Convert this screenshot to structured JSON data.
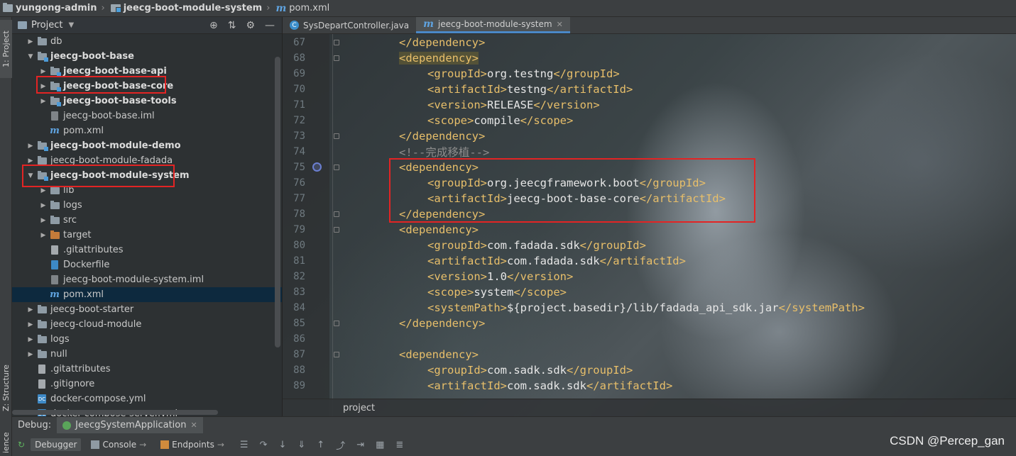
{
  "breadcrumb": {
    "items": [
      "yungong-admin",
      "jeecg-boot-module-system",
      "pom.xml"
    ]
  },
  "left_stripe": {
    "project_tab": "1: Project",
    "structure_tab": "Z: Structure",
    "services_tab": "ience"
  },
  "project_panel": {
    "title": "Project",
    "tree": [
      {
        "label": "db",
        "icon": "folder-icon",
        "arrow": "right",
        "depth": 0,
        "bold": false
      },
      {
        "label": "jeecg-boot-base",
        "icon": "module-folder-icon",
        "arrow": "down",
        "depth": 0,
        "bold": true
      },
      {
        "label": "jeecg-boot-base-api",
        "icon": "module-folder-icon",
        "arrow": "right",
        "depth": 1,
        "bold": true
      },
      {
        "label": "jeecg-boot-base-core",
        "icon": "module-folder-icon",
        "arrow": "right",
        "depth": 1,
        "bold": true
      },
      {
        "label": "jeecg-boot-base-tools",
        "icon": "module-folder-icon",
        "arrow": "right",
        "depth": 1,
        "bold": true
      },
      {
        "label": "jeecg-boot-base.iml",
        "icon": "iml-file-icon",
        "arrow": "",
        "depth": 1,
        "bold": false
      },
      {
        "label": "pom.xml",
        "icon": "maven-icon",
        "arrow": "",
        "depth": 1,
        "bold": false
      },
      {
        "label": "jeecg-boot-module-demo",
        "icon": "module-folder-icon",
        "arrow": "right",
        "depth": 0,
        "bold": true
      },
      {
        "label": "jeecg-boot-module-fadada",
        "icon": "folder-icon",
        "arrow": "right",
        "depth": 0,
        "bold": false
      },
      {
        "label": "jeecg-boot-module-system",
        "icon": "module-folder-icon",
        "arrow": "down",
        "depth": 0,
        "bold": true
      },
      {
        "label": "lib",
        "icon": "folder-icon",
        "arrow": "right",
        "depth": 1,
        "bold": false
      },
      {
        "label": "logs",
        "icon": "folder-icon",
        "arrow": "right",
        "depth": 1,
        "bold": false
      },
      {
        "label": "src",
        "icon": "folder-icon",
        "arrow": "right",
        "depth": 1,
        "bold": false
      },
      {
        "label": "target",
        "icon": "orange-folder-icon",
        "arrow": "right",
        "depth": 1,
        "bold": false
      },
      {
        "label": ".gitattributes",
        "icon": "file-icon",
        "arrow": "",
        "depth": 1,
        "bold": false
      },
      {
        "label": "Dockerfile",
        "icon": "docker-file-icon",
        "arrow": "",
        "depth": 1,
        "bold": false
      },
      {
        "label": "jeecg-boot-module-system.iml",
        "icon": "iml-file-icon",
        "arrow": "",
        "depth": 1,
        "bold": false
      },
      {
        "label": "pom.xml",
        "icon": "maven-icon",
        "arrow": "",
        "depth": 1,
        "bold": false,
        "selected": true
      },
      {
        "label": "jeecg-boot-starter",
        "icon": "folder-icon",
        "arrow": "right",
        "depth": 0,
        "bold": false
      },
      {
        "label": "jeecg-cloud-module",
        "icon": "folder-icon",
        "arrow": "right",
        "depth": 0,
        "bold": false
      },
      {
        "label": "logs",
        "icon": "folder-icon",
        "arrow": "right",
        "depth": 0,
        "bold": false
      },
      {
        "label": "null",
        "icon": "folder-icon",
        "arrow": "right",
        "depth": 0,
        "bold": false
      },
      {
        "label": ".gitattributes",
        "icon": "file-icon",
        "arrow": "",
        "depth": 0,
        "bold": false
      },
      {
        "label": ".gitignore",
        "icon": "file-icon",
        "arrow": "",
        "depth": 0,
        "bold": false
      },
      {
        "label": "docker-compose.yml",
        "icon": "docker-compose-icon",
        "arrow": "",
        "depth": 0,
        "bold": false
      },
      {
        "label": "docker-compose-server.yml",
        "icon": "docker-compose-icon",
        "arrow": "",
        "depth": 0,
        "bold": false
      }
    ]
  },
  "editor": {
    "tabs": [
      {
        "label": "SysDepartController.java",
        "icon": "java-class-icon",
        "active": false
      },
      {
        "label": "jeecg-boot-module-system",
        "icon": "maven-icon",
        "active": true
      }
    ],
    "lines": [
      {
        "n": "67",
        "indent": 1,
        "parts": [
          [
            "tag",
            "</dependency>"
          ]
        ]
      },
      {
        "n": "68",
        "indent": 1,
        "parts": [
          [
            "taghl",
            "<dependency>"
          ]
        ]
      },
      {
        "n": "69",
        "indent": 2,
        "parts": [
          [
            "tag",
            "<groupId>"
          ],
          [
            "txt",
            "org.testng"
          ],
          [
            "tag",
            "</groupId>"
          ]
        ]
      },
      {
        "n": "70",
        "indent": 2,
        "parts": [
          [
            "tag",
            "<artifactId>"
          ],
          [
            "txt",
            "testng"
          ],
          [
            "tag",
            "</artifactId>"
          ]
        ]
      },
      {
        "n": "71",
        "indent": 2,
        "parts": [
          [
            "tag",
            "<version>"
          ],
          [
            "txt",
            "RELEASE"
          ],
          [
            "tag",
            "</version>"
          ]
        ]
      },
      {
        "n": "72",
        "indent": 2,
        "parts": [
          [
            "tag",
            "<scope>"
          ],
          [
            "txt",
            "compile"
          ],
          [
            "tag",
            "</scope>"
          ]
        ]
      },
      {
        "n": "73",
        "indent": 1,
        "parts": [
          [
            "tag",
            "</dependency>"
          ]
        ]
      },
      {
        "n": "74",
        "indent": 1,
        "parts": [
          [
            "cmt",
            "<!--完成移植-->"
          ]
        ]
      },
      {
        "n": "75",
        "indent": 1,
        "parts": [
          [
            "tag",
            "<dependency>"
          ]
        ]
      },
      {
        "n": "76",
        "indent": 2,
        "parts": [
          [
            "tag",
            "<groupId>"
          ],
          [
            "txt",
            "org.jeecgframework.boot"
          ],
          [
            "tag",
            "</groupId>"
          ]
        ]
      },
      {
        "n": "77",
        "indent": 2,
        "parts": [
          [
            "tag",
            "<artifactId>"
          ],
          [
            "txt",
            "jeecg-boot-base-core"
          ],
          [
            "tag",
            "</artifactId>"
          ]
        ]
      },
      {
        "n": "78",
        "indent": 1,
        "parts": [
          [
            "tag",
            "</dependency>"
          ]
        ]
      },
      {
        "n": "79",
        "indent": 1,
        "parts": [
          [
            "tag",
            "<dependency>"
          ]
        ]
      },
      {
        "n": "80",
        "indent": 2,
        "parts": [
          [
            "tag",
            "<groupId>"
          ],
          [
            "txt",
            "com.fadada.sdk"
          ],
          [
            "tag",
            "</groupId>"
          ]
        ]
      },
      {
        "n": "81",
        "indent": 2,
        "parts": [
          [
            "tag",
            "<artifactId>"
          ],
          [
            "txt",
            "com.fadada.sdk"
          ],
          [
            "tag",
            "</artifactId>"
          ]
        ]
      },
      {
        "n": "82",
        "indent": 2,
        "parts": [
          [
            "tag",
            "<version>"
          ],
          [
            "txt",
            "1.0"
          ],
          [
            "tag",
            "</version>"
          ]
        ]
      },
      {
        "n": "83",
        "indent": 2,
        "parts": [
          [
            "tag",
            "<scope>"
          ],
          [
            "txt",
            "system"
          ],
          [
            "tag",
            "</scope>"
          ]
        ]
      },
      {
        "n": "84",
        "indent": 2,
        "parts": [
          [
            "tag",
            "<systemPath>"
          ],
          [
            "txt",
            "${project.basedir}/lib/fadada_api_sdk.jar"
          ],
          [
            "tag",
            "</systemPath>"
          ]
        ]
      },
      {
        "n": "85",
        "indent": 1,
        "parts": [
          [
            "tag",
            "</dependency>"
          ]
        ]
      },
      {
        "n": "86",
        "indent": 0,
        "parts": []
      },
      {
        "n": "87",
        "indent": 1,
        "parts": [
          [
            "tag",
            "<dependency>"
          ]
        ]
      },
      {
        "n": "88",
        "indent": 2,
        "parts": [
          [
            "tag",
            "<groupId>"
          ],
          [
            "txt",
            "com.sadk.sdk"
          ],
          [
            "tag",
            "</groupId>"
          ]
        ]
      },
      {
        "n": "89",
        "indent": 2,
        "parts": [
          [
            "tag",
            "<artifactId>"
          ],
          [
            "txt",
            "com.sadk.sdk"
          ],
          [
            "tag",
            "</artifactId>"
          ]
        ]
      }
    ],
    "bottom_breadcrumb": "project"
  },
  "debug": {
    "label": "Debug:",
    "run_config": "JeecgSystemApplication",
    "toolbar": {
      "debugger": "Debugger",
      "console": "Console",
      "endpoints": "Endpoints"
    }
  },
  "watermark": "CSDN @Percep_gan",
  "colors": {
    "highlight_box": "#e32424",
    "xml_tag": "#e8bf6a",
    "selection": "#0d293e"
  }
}
